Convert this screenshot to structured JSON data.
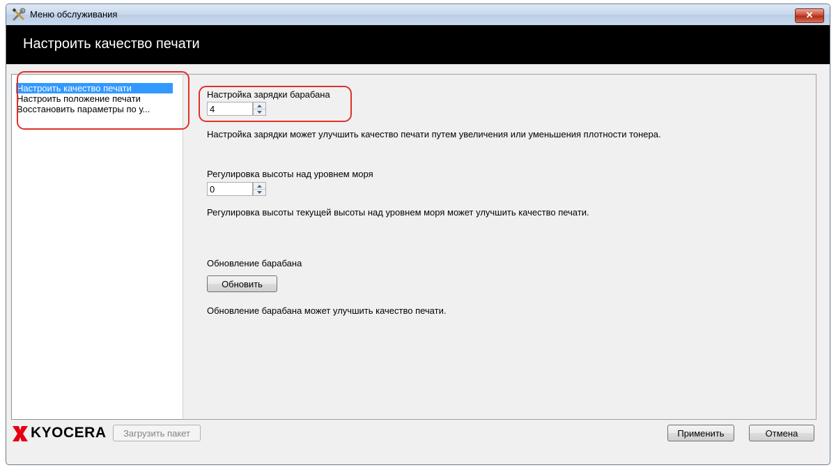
{
  "window": {
    "title": "Меню обслуживания",
    "close_glyph": "✕",
    "icon": "tools-icon"
  },
  "banner": {
    "heading": "Настроить качество печати"
  },
  "nav": {
    "items": [
      {
        "label": "Настроить качество печати",
        "selected": true
      },
      {
        "label": "Настроить положение печати",
        "selected": false
      },
      {
        "label": "Восстановить параметры по у...",
        "selected": false
      }
    ]
  },
  "drum_charge": {
    "label": "Настройка зарядки барабана",
    "value": "4",
    "description": "Настройка зарядки может улучшить качество печати путем увеличения или уменьшения плотности тонера."
  },
  "altitude": {
    "label": "Регулировка высоты над уровнем моря",
    "value": "0",
    "description": "Регулировка высоты текущей высоты над уровнем моря может улучшить качество печати."
  },
  "drum_refresh": {
    "label": "Обновление барабана",
    "button": "Обновить",
    "description": "Обновление барабана может улучшить качество печати."
  },
  "footer": {
    "logo_text": "KYOCERA",
    "load_package": "Загрузить пакет",
    "apply": "Применить",
    "cancel": "Отмена"
  },
  "colors": {
    "accent_selection": "#3399ff",
    "highlight": "#e0302a",
    "banner": "#000000",
    "logo_red": "#e60012"
  }
}
